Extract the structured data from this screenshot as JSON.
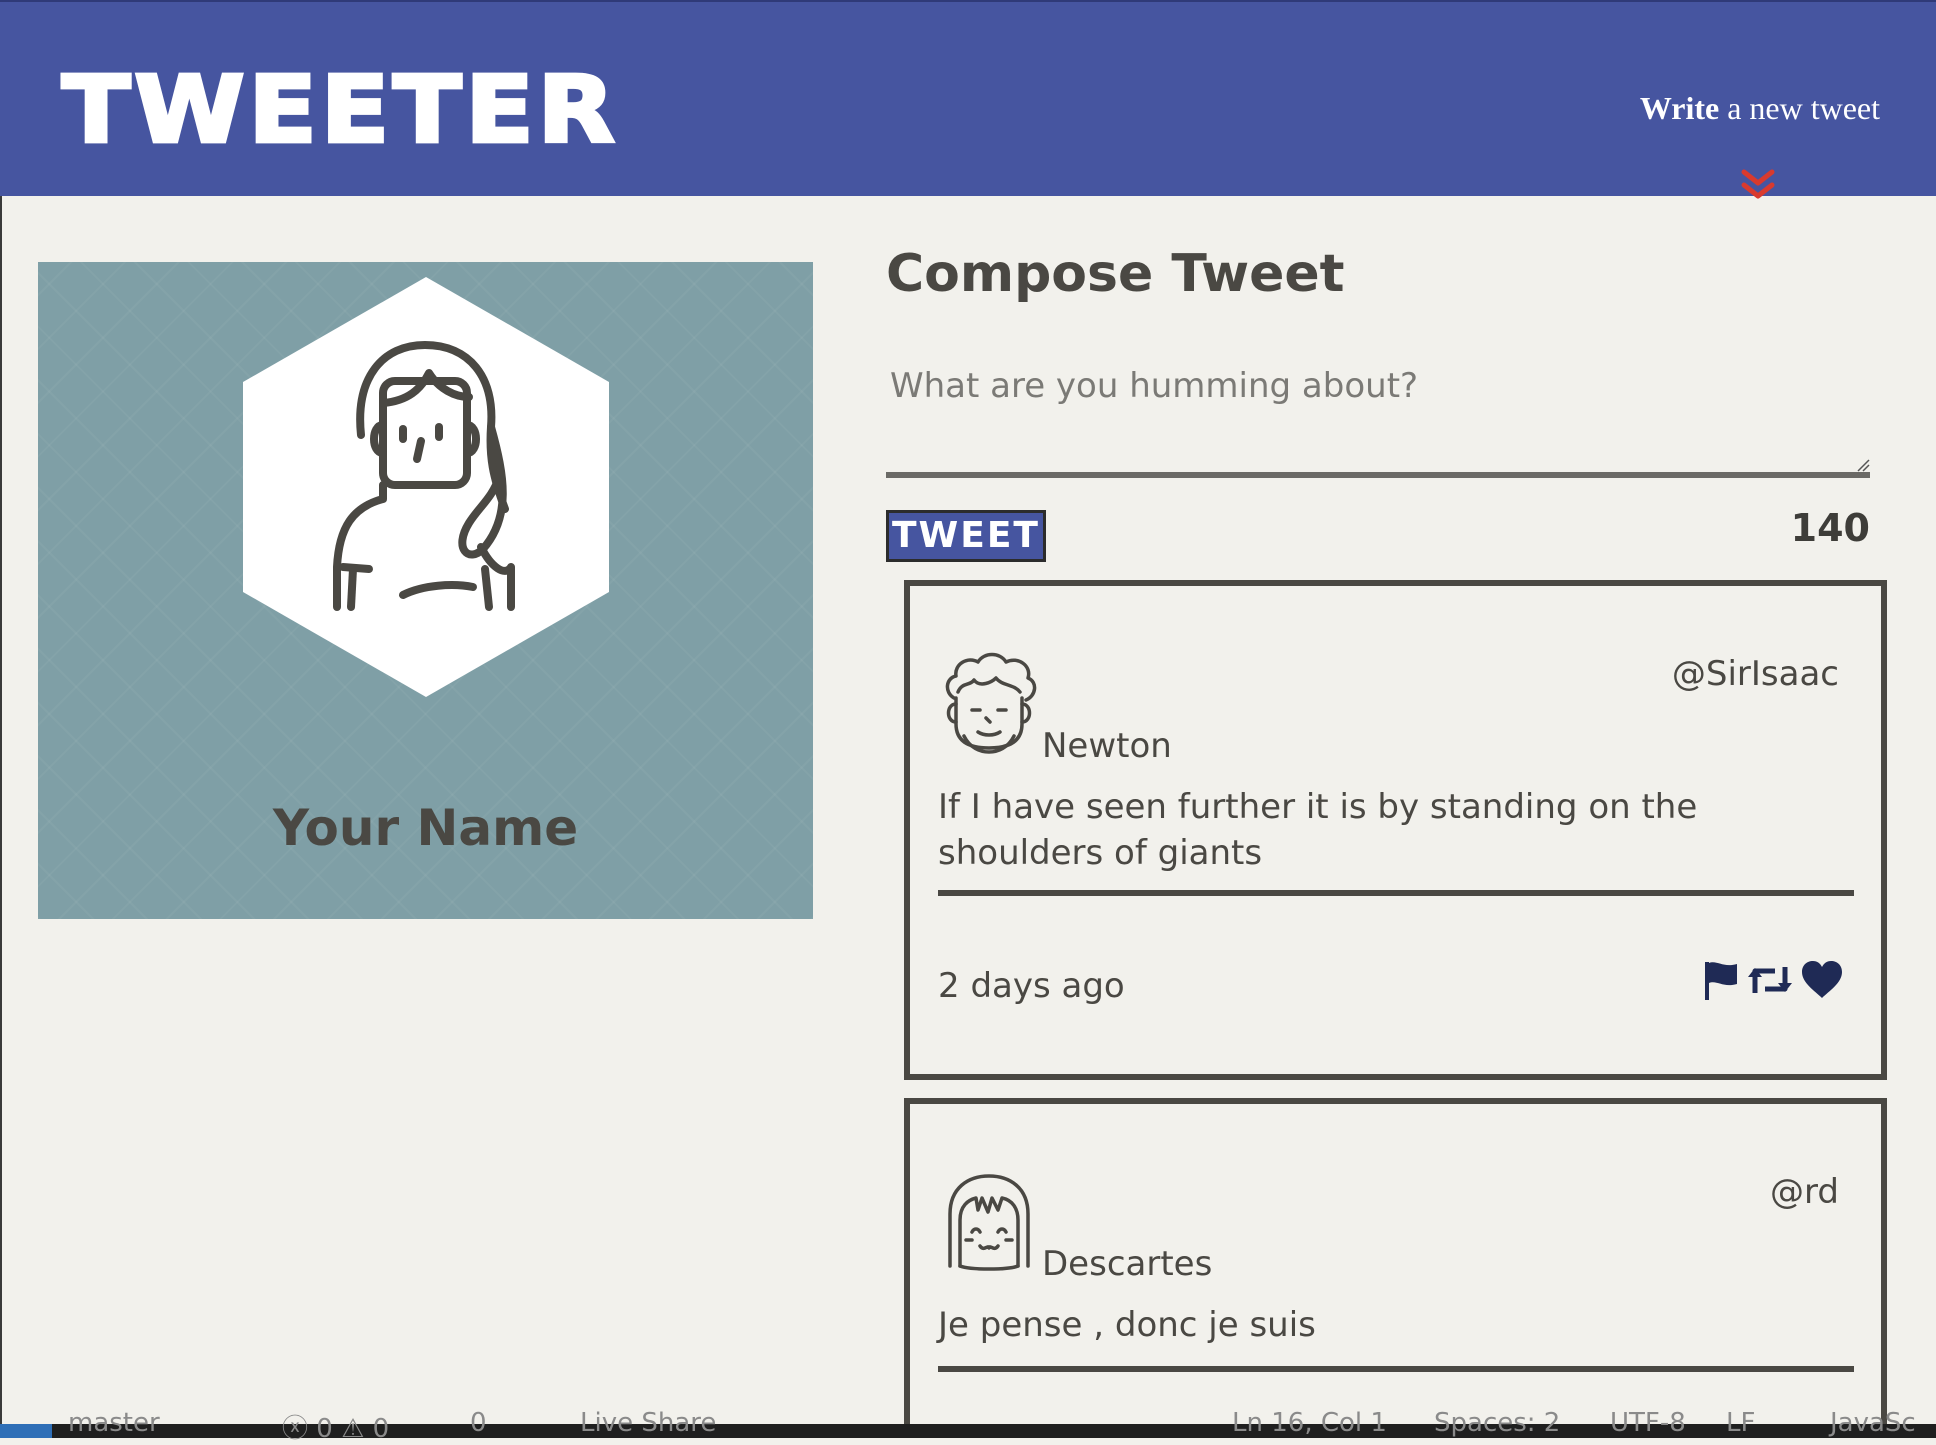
{
  "header": {
    "brand": "TWEETER",
    "compose_toggle_bold": "Write",
    "compose_toggle_rest": " a new tweet",
    "chevron_icon": "double-chevron-down",
    "accent_color": "#4655a0",
    "chevron_color": "#d93a2e"
  },
  "profile": {
    "name": "Your Name",
    "avatar_icon": "woman-avatar",
    "card_color": "#7f9fa6"
  },
  "compose": {
    "title": "Compose Tweet",
    "placeholder": "What are you humming about?",
    "submit_label": "TWEET",
    "counter": "140"
  },
  "tweets": [
    {
      "author": "Newton",
      "handle": "@SirIsaac",
      "avatar_icon": "curly-hair-man-avatar",
      "content": "If I have seen further it is by standing on the shoulders of giants",
      "timestamp": "2 days ago",
      "actions": [
        "flag-icon",
        "retweet-icon",
        "heart-icon"
      ]
    },
    {
      "author": "Descartes",
      "handle": "@rd",
      "avatar_icon": "bob-hair-avatar",
      "content": "Je pense , donc je suis"
    }
  ],
  "status_bar": {
    "branch": "master",
    "problems": "ⓧ 0 ⚠ 0",
    "ports": "0",
    "live_share": "Live Share",
    "cursor": "Ln 16, Col 1",
    "spaces": "Spaces: 2",
    "encoding": "UTF-8",
    "eol": "LF",
    "language": "JavaSc"
  }
}
